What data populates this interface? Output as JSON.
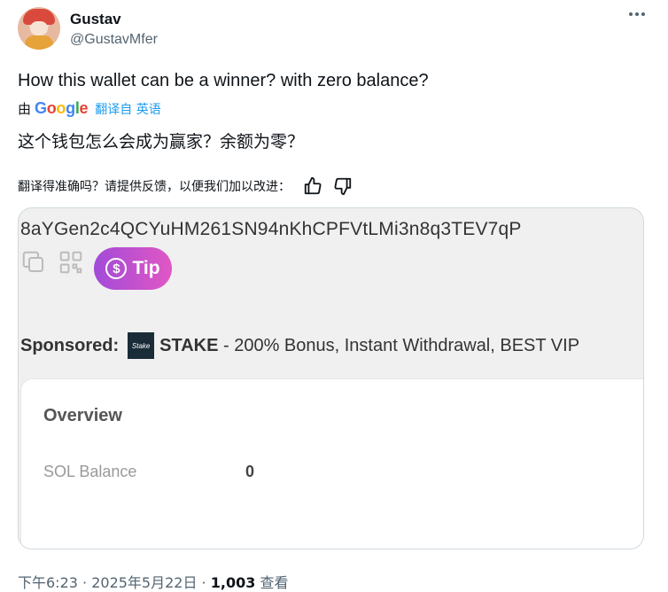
{
  "author": {
    "name": "Gustav",
    "handle": "@GustavMfer"
  },
  "tweet": {
    "text": "How this wallet can be a winner? with zero balance?",
    "translate_prefix": "由",
    "translate_provider": "Google",
    "translate_link": "翻译自 英语",
    "translated_text": "这个钱包怎么会成为赢家？余额为零？",
    "feedback_prompt": "翻译得准确吗？请提供反馈，以便我们加以改进："
  },
  "card": {
    "address": "8aYGen2c4QCYuHM261SN94nKhCPFVtLMi3n8q3TEV7qP",
    "tip_label": "Tip",
    "sponsored_label": "Sponsored:",
    "sponsor_logo_text": "Stake",
    "sponsor_name": "STAKE",
    "sponsor_text": " - 200% Bonus, Instant Withdrawal, BEST VIP",
    "overview_title": "Overview",
    "sol_balance_label": "SOL Balance",
    "sol_balance_value": "0"
  },
  "meta": {
    "time": "下午6:23",
    "date": "2025年5月22日",
    "views_count": "1,003",
    "views_label": "查看"
  },
  "icons": [
    "more-icon",
    "thumbs-up-icon",
    "thumbs-down-icon",
    "copy-icon",
    "qr-icon",
    "dollar-coin-icon"
  ]
}
